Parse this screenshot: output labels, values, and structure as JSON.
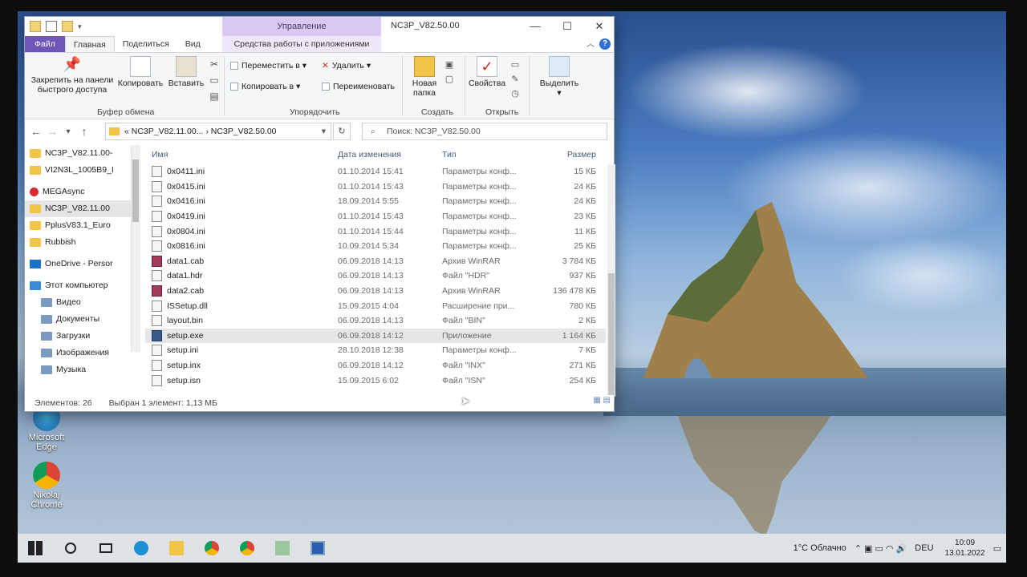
{
  "window": {
    "title": "NC3P_V82.50.00",
    "context_tab": "Управление",
    "minimize": "—",
    "maximize": "☐",
    "close": "✕"
  },
  "tabs": {
    "file": "Файл",
    "home": "Главная",
    "share": "Поделиться",
    "view": "Вид",
    "app_tools": "Средства работы с приложениями",
    "help": "?"
  },
  "ribbon": {
    "pin_line1": "Закрепить на панели",
    "pin_line2": "быстрого доступа",
    "copy": "Копировать",
    "paste": "Вставить",
    "clipboard_group": "Буфер обмена",
    "move_to": "Переместить в ▾",
    "delete": "Удалить ▾",
    "copy_to": "Копировать в ▾",
    "rename": "Переименовать",
    "organize_group": "Упорядочить",
    "new_folder_line1": "Новая",
    "new_folder_line2": "папка",
    "create_group": "Создать",
    "properties": "Свойства",
    "open_group": "Открыть",
    "select": "Выделить",
    "select_arrow": "▾"
  },
  "address": {
    "back": "←",
    "forward": "→",
    "recent": "▾",
    "up": "↑",
    "path": "«  NC3P_V82.11.00...  ›  NC3P_V82.50.00",
    "dropdown": "▾",
    "refresh": "↻",
    "search_placeholder": "Поиск: NC3P_V82.50.00"
  },
  "navpane": {
    "items": [
      {
        "label": "NC3P_V82.11.00-",
        "selected": false
      },
      {
        "label": "VI2N3L_1005B9_I",
        "selected": false
      },
      {
        "label": "MEGAsync",
        "selected": false
      },
      {
        "label": "NC3P_V82.11.00",
        "selected": true
      },
      {
        "label": "PplusV83.1_Euro",
        "selected": false
      },
      {
        "label": "Rubbish",
        "selected": false
      },
      {
        "label": "OneDrive - Persor",
        "selected": false
      },
      {
        "label": "Этот компьютер",
        "selected": false
      },
      {
        "label": "Видео",
        "selected": false
      },
      {
        "label": "Документы",
        "selected": false
      },
      {
        "label": "Загрузки",
        "selected": false
      },
      {
        "label": "Изображения",
        "selected": false
      },
      {
        "label": "Музыка",
        "selected": false
      }
    ]
  },
  "filelist": {
    "headers": {
      "name": "Имя",
      "date": "Дата изменения",
      "type": "Тип",
      "size": "Размер"
    },
    "rows": [
      {
        "name": "0x0411.ini",
        "date": "01.10.2014 15:41",
        "type": "Параметры конф...",
        "size": "15 КБ",
        "kind": "ini"
      },
      {
        "name": "0x0415.ini",
        "date": "01.10.2014 15:43",
        "type": "Параметры конф...",
        "size": "24 КБ",
        "kind": "ini"
      },
      {
        "name": "0x0416.ini",
        "date": "18.09.2014 5:55",
        "type": "Параметры конф...",
        "size": "24 КБ",
        "kind": "ini"
      },
      {
        "name": "0x0419.ini",
        "date": "01.10.2014 15:43",
        "type": "Параметры конф...",
        "size": "23 КБ",
        "kind": "ini"
      },
      {
        "name": "0x0804.ini",
        "date": "01.10.2014 15:44",
        "type": "Параметры конф...",
        "size": "11 КБ",
        "kind": "ini"
      },
      {
        "name": "0x0816.ini",
        "date": "10.09.2014 5:34",
        "type": "Параметры конф...",
        "size": "25 КБ",
        "kind": "ini"
      },
      {
        "name": "data1.cab",
        "date": "06.09.2018 14:13",
        "type": "Архив WinRAR",
        "size": "3 784 КБ",
        "kind": "rar"
      },
      {
        "name": "data1.hdr",
        "date": "06.09.2018 14:13",
        "type": "Файл \"HDR\"",
        "size": "937 КБ",
        "kind": "file"
      },
      {
        "name": "data2.cab",
        "date": "06.09.2018 14:13",
        "type": "Архив WinRAR",
        "size": "136 478 КБ",
        "kind": "rar"
      },
      {
        "name": "ISSetup.dll",
        "date": "15.09.2015 4:04",
        "type": "Расширение при...",
        "size": "780 КБ",
        "kind": "file"
      },
      {
        "name": "layout.bin",
        "date": "06.09.2018 14:13",
        "type": "Файл \"BIN\"",
        "size": "2 КБ",
        "kind": "file"
      },
      {
        "name": "setup.exe",
        "date": "06.09.2018 14:12",
        "type": "Приложение",
        "size": "1 164 КБ",
        "kind": "exe",
        "selected": true
      },
      {
        "name": "setup.ini",
        "date": "28.10.2018 12:38",
        "type": "Параметры конф...",
        "size": "7 КБ",
        "kind": "ini"
      },
      {
        "name": "setup.inx",
        "date": "06.09.2018 14:12",
        "type": "Файл \"INX\"",
        "size": "271 КБ",
        "kind": "file"
      },
      {
        "name": "setup.isn",
        "date": "15.09.2015 6:02",
        "type": "Файл \"ISN\"",
        "size": "254 КБ",
        "kind": "file"
      }
    ]
  },
  "status": {
    "count": "Элементов: 26",
    "selected": "Выбран 1 элемент: 1,13 МБ"
  },
  "desktop": {
    "edge_line1": "Microsoft",
    "edge_line2": "Edge",
    "chrome_line1": "Nikolaj",
    "chrome_line2": "Chrome"
  },
  "taskbar": {
    "weather": "1°C  Облачно",
    "lang": "DEU",
    "time": "10:09",
    "date": "13.01.2022"
  },
  "colors": {
    "file_tab": "#6e56b9",
    "context_tab": "#d9c9f3",
    "selection": "#e6e6e6"
  }
}
